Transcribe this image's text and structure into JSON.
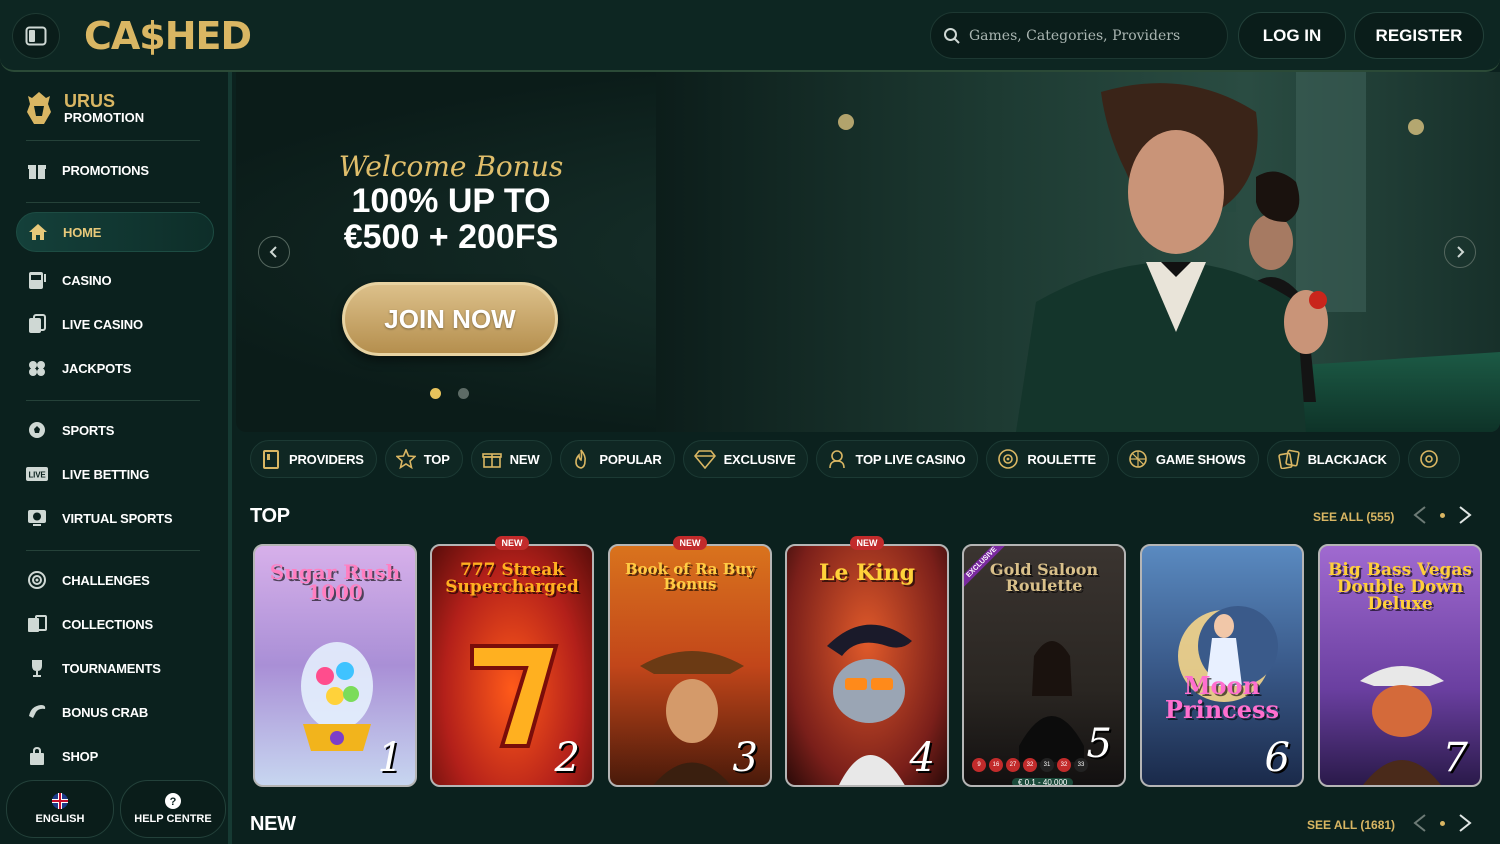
{
  "header": {
    "logo_text": "CA$HED",
    "search_placeholder": "Games, Categories, Providers",
    "login_label": "LOG IN",
    "register_label": "REGISTER"
  },
  "sidebar": {
    "promo_title": "URUS",
    "promo_subtitle": "PROMOTION",
    "items": [
      {
        "label": "PROMOTIONS",
        "icon": "gift-icon"
      },
      {
        "label": "HOME",
        "icon": "home-icon"
      },
      {
        "label": "CASINO",
        "icon": "slot-machine-icon"
      },
      {
        "label": "LIVE CASINO",
        "icon": "live-cards-icon"
      },
      {
        "label": "JACKPOTS",
        "icon": "clover-icon"
      },
      {
        "label": "SPORTS",
        "icon": "soccer-ball-icon"
      },
      {
        "label": "LIVE BETTING",
        "icon": "live-badge-icon"
      },
      {
        "label": "VIRTUAL SPORTS",
        "icon": "virtual-sports-icon"
      },
      {
        "label": "CHALLENGES",
        "icon": "target-icon"
      },
      {
        "label": "COLLECTIONS",
        "icon": "collection-icon"
      },
      {
        "label": "TOURNAMENTS",
        "icon": "trophy-icon"
      },
      {
        "label": "BONUS CRAB",
        "icon": "claw-icon"
      },
      {
        "label": "SHOP",
        "icon": "shopping-bag-icon"
      }
    ],
    "language_label": "ENGLISH",
    "help_label": "HELP CENTRE"
  },
  "hero": {
    "welcome": "Welcome Bonus",
    "line1": "100% UP TO",
    "line2": "€500 + 200FS",
    "cta": "JOIN NOW",
    "slides_total": 2,
    "slide_active": 1
  },
  "categories": [
    {
      "label": "PROVIDERS",
      "icon": "book-icon"
    },
    {
      "label": "TOP",
      "icon": "star-icon"
    },
    {
      "label": "NEW",
      "icon": "gift-box-icon"
    },
    {
      "label": "POPULAR",
      "icon": "flame-icon"
    },
    {
      "label": "EXCLUSIVE",
      "icon": "diamond-icon"
    },
    {
      "label": "TOP LIVE CASINO",
      "icon": "dealer-icon"
    },
    {
      "label": "ROULETTE",
      "icon": "roulette-icon"
    },
    {
      "label": "GAME SHOWS",
      "icon": "wheel-icon"
    },
    {
      "label": "BLACKJACK",
      "icon": "cards-icon"
    },
    {
      "label": "",
      "icon": "chip-icon"
    }
  ],
  "sections": {
    "top": {
      "title": "TOP",
      "see_all": "SEE ALL (555)"
    },
    "new": {
      "title": "NEW",
      "see_all": "SEE ALL (1681)"
    }
  },
  "games": [
    {
      "title": "Sugar Rush 1000",
      "rank": "1",
      "badge": "",
      "bg": "#a98fd6",
      "title_color": "#ff7fc0"
    },
    {
      "title": "777 Streak Supercharged",
      "rank": "2",
      "badge": "NEW",
      "bg": "#b3201a",
      "title_color": "#ffb020"
    },
    {
      "title": "Book of Ra Buy Bonus",
      "rank": "3",
      "badge": "NEW",
      "bg": "#c2461a",
      "title_color": "#ffcc44"
    },
    {
      "title": "Le King",
      "rank": "4",
      "badge": "NEW",
      "bg": "#7a1f1a",
      "title_color": "#ffd23a"
    },
    {
      "title": "Gold Saloon Roulette",
      "rank": "5",
      "badge": "",
      "ribbon": "EXCLUSIVE",
      "bg": "#2a2622",
      "title_color": "#d9c08a",
      "limits": "€ 0.1 - 40,000",
      "numbers": [
        "9",
        "16",
        "27",
        "32",
        "31",
        "32",
        "33"
      ]
    },
    {
      "title": "Moon Princess",
      "rank": "6",
      "badge": "",
      "bg": "#3a5a8a",
      "title_color": "#ff6fcf"
    },
    {
      "title": "Big Bass Vegas Double Down Deluxe",
      "rank": "7",
      "badge": "",
      "bg": "#6a3fa0",
      "title_color": "#ffcf3a"
    }
  ]
}
